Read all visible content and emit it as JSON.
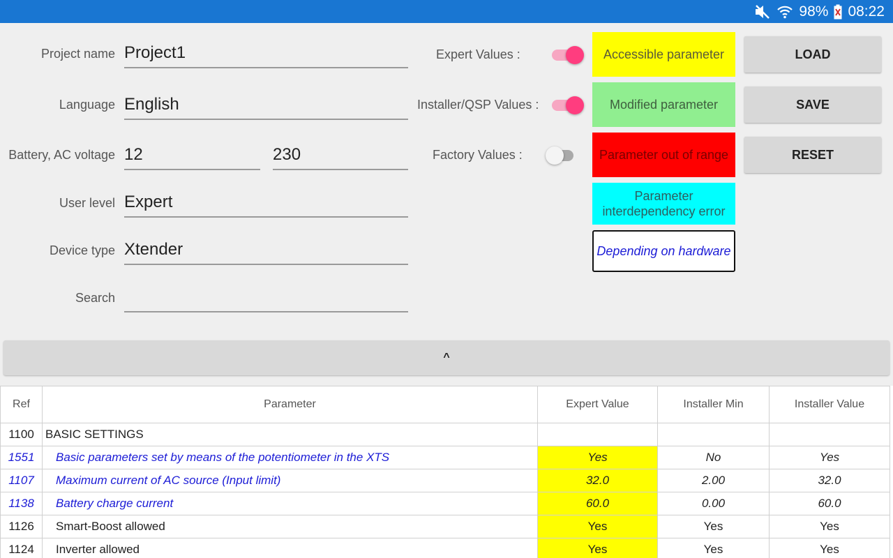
{
  "status_bar": {
    "battery_pct": "98%",
    "time": "08:22",
    "icons": [
      "mute-icon",
      "wifi-icon",
      "battery-icon"
    ]
  },
  "form": {
    "project_name": {
      "label": "Project name",
      "value": "Project1"
    },
    "language": {
      "label": "Language",
      "value": "English"
    },
    "battery_ac": {
      "label": "Battery, AC voltage",
      "battery_value": "12",
      "ac_value": "230"
    },
    "user_level": {
      "label": "User level",
      "value": "Expert"
    },
    "device_type": {
      "label": "Device type",
      "value": "Xtender"
    },
    "search": {
      "label": "Search",
      "value": ""
    }
  },
  "switches": {
    "expert": {
      "label": "Expert Values :",
      "on": true
    },
    "installer": {
      "label": "Installer/QSP Values :",
      "on": true
    },
    "factory": {
      "label": "Factory Values :",
      "on": false
    }
  },
  "legend": {
    "accessible": {
      "label": "Accessible parameter",
      "color": "#ffff00",
      "text_color": "#5a5a3a"
    },
    "modified": {
      "label": "Modified parameter",
      "color": "#90ee90",
      "text_color": "#3e5e3e"
    },
    "out_of_range": {
      "label": "Parameter out of range",
      "color": "#ff0000",
      "text_color": "#7a0000"
    },
    "interdependency": {
      "label_line1": "Parameter",
      "label_line2": "interdependency error",
      "color": "#00ffff",
      "text_color": "#2e5e5e"
    },
    "hardware": {
      "label": "Depending on hardware",
      "color": "#ffffff",
      "text_color": "#1c1cd6"
    }
  },
  "buttons": {
    "load": "LOAD",
    "save": "SAVE",
    "reset": "RESET"
  },
  "collapse_toggle": "^",
  "table": {
    "headers": [
      "Ref",
      "Parameter",
      "Expert Value",
      "Installer Min",
      "Installer Value"
    ],
    "rows": [
      {
        "ref": "1100",
        "param": "BASIC SETTINGS",
        "expert": "",
        "inst_min": "",
        "inst_val": ""
      },
      {
        "ref": "1551",
        "param": "Basic parameters set by means of the potentiometer in the XTS",
        "expert": "Yes",
        "inst_min": "No",
        "inst_val": "Yes"
      },
      {
        "ref": "1107",
        "param": "Maximum current of AC source (Input limit)",
        "expert": "32.0",
        "inst_min": "2.00",
        "inst_val": "32.0"
      },
      {
        "ref": "1138",
        "param": "Battery charge current",
        "expert": "60.0",
        "inst_min": "0.00",
        "inst_val": "60.0"
      },
      {
        "ref": "1126",
        "param": "Smart-Boost allowed",
        "expert": "Yes",
        "inst_min": "Yes",
        "inst_val": "Yes"
      },
      {
        "ref": "1124",
        "param": "Inverter allowed",
        "expert": "Yes",
        "inst_min": "Yes",
        "inst_val": "Yes"
      }
    ]
  }
}
